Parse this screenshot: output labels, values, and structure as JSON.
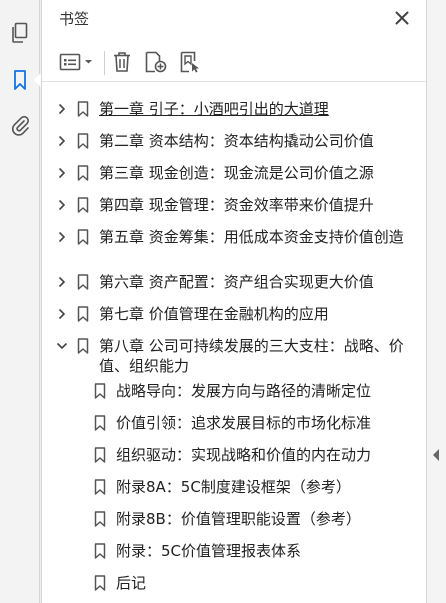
{
  "panel": {
    "title": "书签",
    "close_icon": "close-icon"
  },
  "rail": {
    "items": [
      {
        "icon": "pages-icon",
        "active": false
      },
      {
        "icon": "bookmark-icon",
        "active": true
      },
      {
        "icon": "attachment-icon",
        "active": false
      }
    ]
  },
  "toolbar": {
    "items": [
      "options-menu-icon",
      "trash-icon",
      "new-bookmark-icon",
      "bookmark-from-selection-icon"
    ]
  },
  "colors": {
    "accent": "#1473e6",
    "icon": "#555555"
  },
  "bookmarks": [
    {
      "label": "第一章  引子：小酒吧引出的大道理",
      "level": 1,
      "expanded": false,
      "selected": true
    },
    {
      "label": "第二章  资本结构：资本结构撬动公司价值",
      "level": 1,
      "expanded": false
    },
    {
      "label": "第三章  现金创造：现金流是公司价值之源",
      "level": 1,
      "expanded": false
    },
    {
      "label": "第四章  现金管理：资金效率带来价值提升",
      "level": 1,
      "expanded": false
    },
    {
      "label": "第五章  资金筹集：用低成本资金支持价值创造",
      "level": 1,
      "expanded": false
    },
    {
      "label": "第六章  资产配置：资产组合实现更大价值",
      "level": 1,
      "expanded": false
    },
    {
      "label": "第七章  价值管理在金融机构的应用",
      "level": 1,
      "expanded": false
    },
    {
      "label": "第八章  公司可持续发展的三大支柱：战略、价值、组织能力",
      "level": 1,
      "expanded": true
    },
    {
      "label": "战略导向：发展方向与路径的清晰定位",
      "level": 2
    },
    {
      "label": "价值引领：追求发展目标的市场化标准",
      "level": 2
    },
    {
      "label": "组织驱动：实现战略和价值的内在动力",
      "level": 2
    },
    {
      "label": "附录8A：5C制度建设框架（参考）",
      "level": 2
    },
    {
      "label": "附录8B：价值管理职能设置（参考）",
      "level": 2
    },
    {
      "label": "附录：5C价值管理报表体系",
      "level": 2
    },
    {
      "label": "后记",
      "level": 2
    }
  ]
}
